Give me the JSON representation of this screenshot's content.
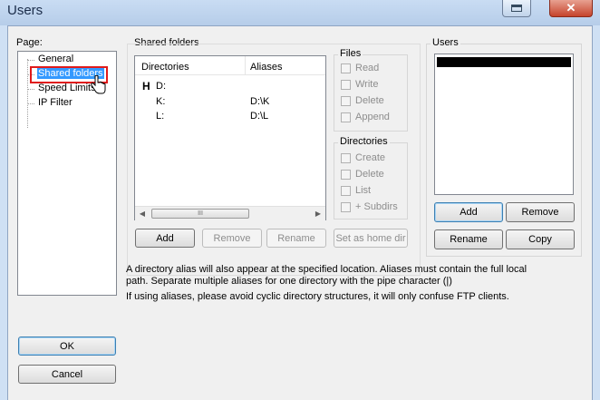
{
  "window": {
    "title": "Users",
    "close_glyph": "✕"
  },
  "page_label": "Page:",
  "nav": {
    "items": [
      {
        "label": "General"
      },
      {
        "label": "Shared folders"
      },
      {
        "label": "Speed Limits"
      },
      {
        "label": "IP Filter"
      }
    ],
    "selected": 1
  },
  "shared": {
    "title": "Shared folders",
    "columns": {
      "directories": "Directories",
      "aliases": "Aliases"
    },
    "rows": [
      {
        "dir": "D:",
        "alias": "",
        "home": true,
        "home_mark": "H"
      },
      {
        "dir": "K:",
        "alias": "D:\\K"
      },
      {
        "dir": "L:",
        "alias": "D:\\L"
      }
    ],
    "scroll_grip": "III",
    "buttons": {
      "add": "Add",
      "remove": "Remove",
      "rename": "Rename",
      "home": "Set as home dir"
    }
  },
  "files": {
    "title": "Files",
    "options": [
      "Read",
      "Write",
      "Delete",
      "Append"
    ]
  },
  "directories": {
    "title": "Directories",
    "options": [
      "Create",
      "Delete",
      "List",
      "+ Subdirs"
    ]
  },
  "users": {
    "title": "Users",
    "buttons": {
      "add": "Add",
      "remove": "Remove",
      "rename": "Rename",
      "copy": "Copy"
    }
  },
  "info": {
    "line1": "A directory alias will also appear at the specified location. Aliases must contain the full local",
    "line2": "path. Separate multiple aliases for one directory with the pipe character (|)",
    "line3": "If using aliases, please avoid cyclic directory structures, it will only confuse FTP clients."
  },
  "footer": {
    "ok": "OK",
    "cancel": "Cancel"
  },
  "colors": {
    "selection": "#3399ff",
    "highlight_box": "#e01b1b",
    "selected_user_bar": "#000000"
  }
}
